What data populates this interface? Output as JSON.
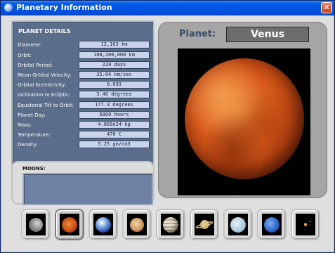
{
  "window": {
    "title": "Planetary Information",
    "close_label": "✕"
  },
  "details": {
    "heading": "PLANET DETAILS",
    "rows": [
      {
        "label": "Diameter:",
        "value": "12,103 km"
      },
      {
        "label": "Orbit:",
        "value": "108,200,000 km"
      },
      {
        "label": "Orbital Period:",
        "value": "220 days"
      },
      {
        "label": "Mean Orbital Velocity:",
        "value": "35.04 km/sec"
      },
      {
        "label": "Orbital  Eccentricity:",
        "value": "0.093"
      },
      {
        "label": "Inclination to Ecliptic:",
        "value": "3.40 degrees"
      },
      {
        "label": "Equatorial Tilt to Orbit:",
        "value": "177.3 degrees"
      },
      {
        "label": "Planet Day:",
        "value": "5800 hours"
      },
      {
        "label": "Mass:",
        "value": "4.869e24 kg"
      },
      {
        "label": "Temperature:",
        "value": "470 C"
      },
      {
        "label": "Density:",
        "value": "5.25 gm/cm3"
      }
    ]
  },
  "moons": {
    "label": "MOONS:",
    "value": ""
  },
  "planet": {
    "label": "Planet:",
    "name": "Venus"
  },
  "thumbnails": [
    {
      "id": "mercury",
      "icon": "mercury-icon",
      "selected": false
    },
    {
      "id": "venus",
      "icon": "venus-icon",
      "selected": true
    },
    {
      "id": "earth",
      "icon": "earth-icon",
      "selected": false
    },
    {
      "id": "mars",
      "icon": "mars-icon",
      "selected": false
    },
    {
      "id": "jupiter",
      "icon": "jupiter-icon",
      "selected": false
    },
    {
      "id": "saturn",
      "icon": "saturn-icon",
      "selected": false
    },
    {
      "id": "uranus",
      "icon": "uranus-icon",
      "selected": false
    },
    {
      "id": "neptune",
      "icon": "neptune-icon",
      "selected": false
    },
    {
      "id": "pluto",
      "icon": "pluto-icon",
      "selected": false
    }
  ],
  "colors": {
    "title_bar": "#0054e3",
    "panel_bg": "#5a6d8a",
    "value_field": "#c9d4ec",
    "planet_name_box": "#6d6d6d"
  }
}
